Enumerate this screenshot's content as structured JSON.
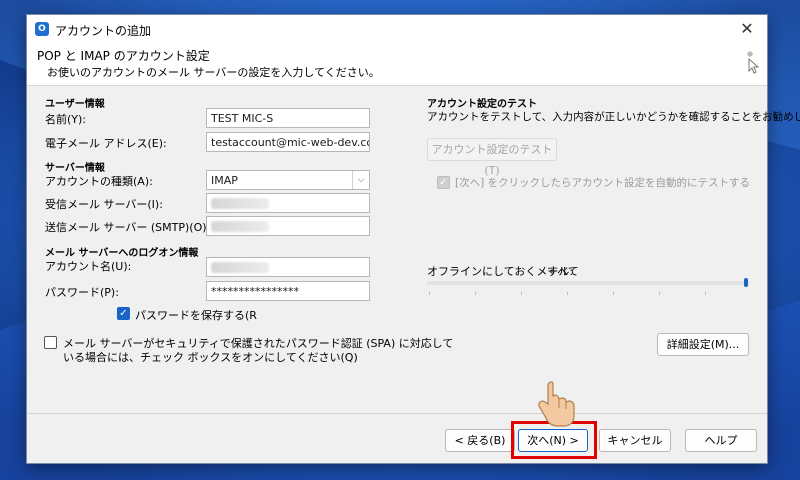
{
  "window": {
    "title": "アカウントの追加",
    "close_glyph": "✕"
  },
  "header": {
    "title": "POP と IMAP のアカウント設定",
    "subtitle": "お使いのアカウントのメール サーバーの設定を入力してください。"
  },
  "user_info": {
    "heading": "ユーザー情報",
    "name_label": "名前(Y):",
    "name_value": "TEST MIC-S",
    "email_label": "電子メール アドレス(E):",
    "email_value": "testaccount@mic-web-dev.com"
  },
  "server_info": {
    "heading": "サーバー情報",
    "account_type_label": "アカウントの種類(A):",
    "account_type_value": "IMAP",
    "incoming_label": "受信メール サーバー(I):",
    "outgoing_label": "送信メール サーバー (SMTP)(O):"
  },
  "logon_info": {
    "heading": "メール サーバーへのログオン情報",
    "account_name_label": "アカウント名(U):",
    "password_label": "パスワード(P):",
    "password_value": "****************",
    "remember_password_label": "パスワードを保存する(R",
    "remember_password_checked": true,
    "spa_label_line1": "メール サーバーがセキュリティで保護されたパスワード認証 (SPA) に対応して",
    "spa_label_line2": "いる場合には、チェック ボックスをオンにしてください(Q)",
    "spa_checked": false
  },
  "test_settings": {
    "heading": "アカウント設定のテスト",
    "description": "アカウントをテストして、入力内容が正しいかどうかを確認することをお勧めします。",
    "test_button": "アカウント設定のテスト(T)",
    "auto_test_label": "[次へ] をクリックしたらアカウント設定を自動的にテストする",
    "auto_test_checked": true
  },
  "offline": {
    "label": "オフラインにしておくメール:",
    "value": "すべて",
    "slider_level_percent": 100
  },
  "buttons": {
    "more_settings": "詳細設定(M)...",
    "back": "< 戻る(B)",
    "next": "次へ(N) >",
    "cancel": "キャンセル",
    "help": "ヘルプ"
  },
  "colors": {
    "accent": "#1a63c7",
    "highlight": "#e00000",
    "dialog_bg": "#f0f0f0",
    "wallpaper": "#1b4fb0"
  },
  "icons": {
    "app": "outlook-icon",
    "header_deco": "sparkle-cursor-icon",
    "pointer": "pointing-hand-icon"
  }
}
